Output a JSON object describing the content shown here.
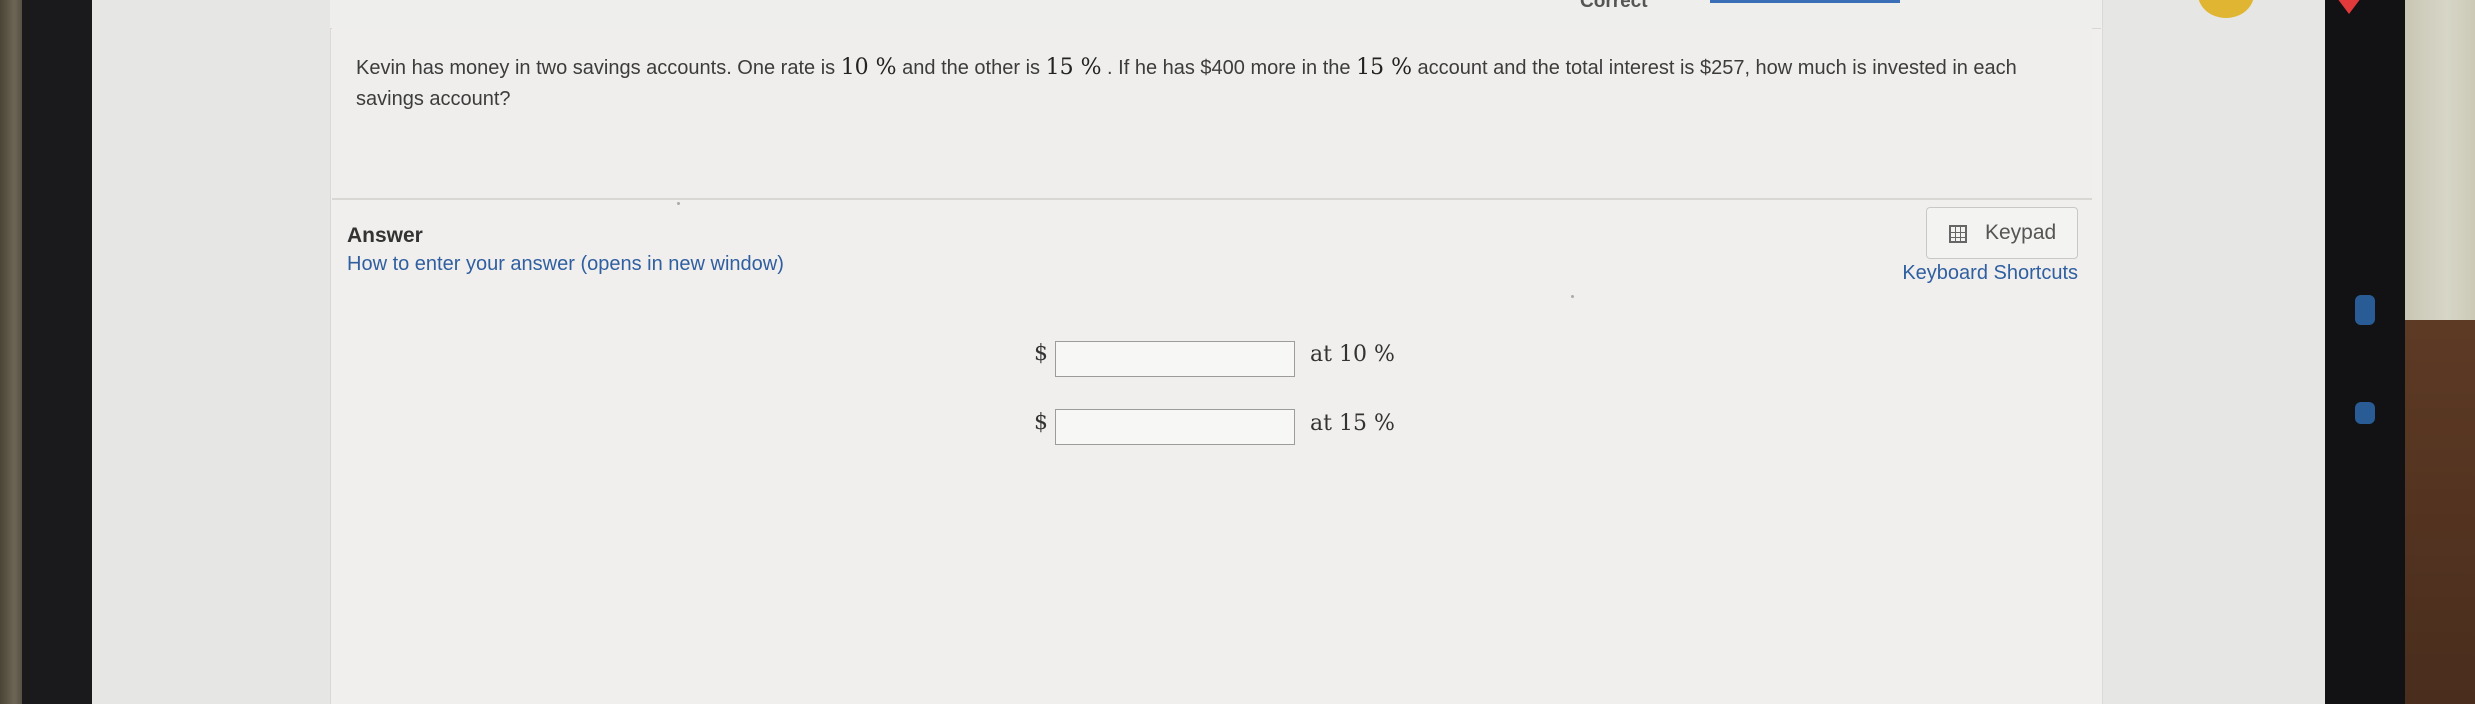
{
  "header": {
    "status_tab": "Correct"
  },
  "question": {
    "segments": [
      {
        "t": "Kevin has money in two savings accounts. One rate is ",
        "math": false
      },
      {
        "t": "10 %",
        "math": true
      },
      {
        "t": "  and the other is ",
        "math": false
      },
      {
        "t": "15 %",
        "math": true
      },
      {
        "t": " . If he has $400 more in the ",
        "math": false
      },
      {
        "t": "15 %",
        "math": true
      },
      {
        "t": "  account and the total interest is $257, how much is invested in each savings account?",
        "math": false
      }
    ]
  },
  "answer": {
    "label": "Answer",
    "help_link": "How to enter your answer (opens in new window)",
    "keypad_label": "Keypad",
    "shortcuts_link": "Keyboard Shortcuts",
    "rows": [
      {
        "currency": "$",
        "value": "",
        "rate_label": "at 10 %"
      },
      {
        "currency": "$",
        "value": "",
        "rate_label": "at 15 %"
      }
    ]
  },
  "colors": {
    "link": "#2f5fa0",
    "card": "#f0efed",
    "coin": "#e0b532",
    "heart": "#e2393a"
  },
  "icons": [
    "keypad-icon",
    "coin-icon",
    "heart-icon"
  ]
}
